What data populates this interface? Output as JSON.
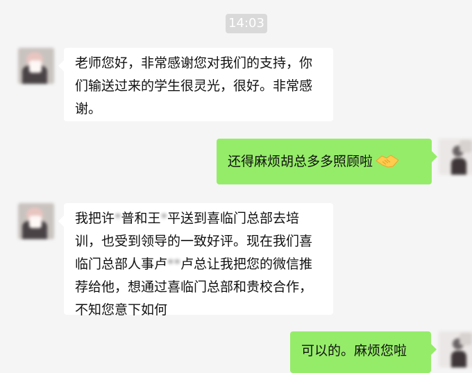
{
  "time_label": "14:03",
  "messages": [
    {
      "side": "in",
      "text": "老师您好，非常感谢您对我们的支持，你们输送过来的学生很灵光，很好。非常感谢。"
    },
    {
      "side": "out",
      "text": "还得麻烦胡总多多照顾啦",
      "emoji": "handshake-icon"
    },
    {
      "side": "in",
      "parts": [
        "我把许",
        "*",
        "普和王",
        "*",
        "平送到喜临门总部去培训，也受到领导的一致好评。现在我们喜临门总部人事卢",
        "**",
        "卢总让我把您的微信推荐给他，想通过喜临门总部和贵校合作，不知您意下如何"
      ]
    },
    {
      "side": "out",
      "text": "可以的。麻烦您啦"
    }
  ],
  "colors": {
    "background": "#f5f5f5",
    "incoming_bubble": "#ffffff",
    "outgoing_bubble": "#95ec69",
    "timestamp_bg": "#d9d9d9"
  }
}
